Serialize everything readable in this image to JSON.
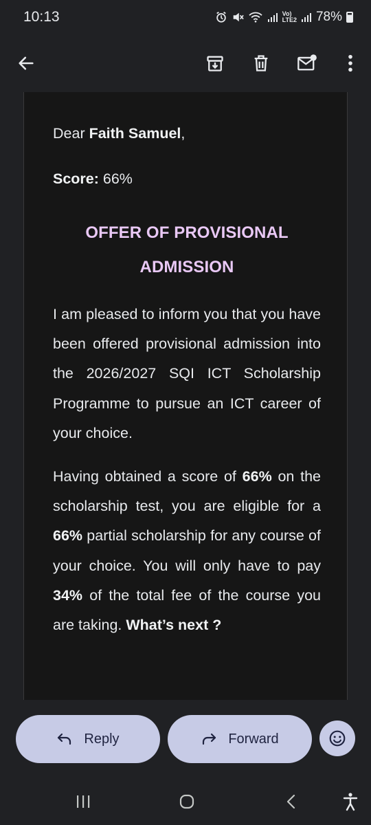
{
  "status_bar": {
    "time": "10:13",
    "battery": "78%",
    "network_label_top": "Vo)",
    "network_label_bottom": "LTE2",
    "icons": [
      "alarm-icon",
      "mute-icon",
      "wifi-icon",
      "signal-icon",
      "signal-icon",
      "battery-icon"
    ]
  },
  "toolbar": {
    "icons": [
      "back-arrow-icon",
      "archive-icon",
      "delete-icon",
      "mark-unread-icon",
      "more-vert-icon"
    ]
  },
  "email": {
    "greeting_prefix": "Dear ",
    "recipient_name": "Faith Samuel",
    "greeting_suffix": ",",
    "score_label": "Score:",
    "score_value": " 66%",
    "offer_title": "OFFER OF PROVISIONAL ADMISSION",
    "paragraph1": "I am pleased to inform you that you have been offered provisional admission into the 2026/2027 SQI ICT Scholarship Programme to pursue an ICT career of your choice.",
    "p2_text1": "Having obtained a score of ",
    "p2_bold1": "66%",
    "p2_text2": " on the scholarship test, you are eligible for a ",
    "p2_bold2": "66%",
    "p2_text3": " partial scholarship for any course of your choice. You will only have to pay ",
    "p2_bold3": "34%",
    "p2_text4": " of the total fee of the course you are taking. ",
    "p2_bold4": "What’s next ?",
    "accent_color": "#e9c8f5"
  },
  "actions": {
    "reply_label": "Reply",
    "forward_label": "Forward",
    "button_color": "#c7cbe6"
  },
  "navbar": {
    "icons": [
      "recent-apps-icon",
      "home-icon",
      "back-icon",
      "accessibility-icon"
    ]
  }
}
